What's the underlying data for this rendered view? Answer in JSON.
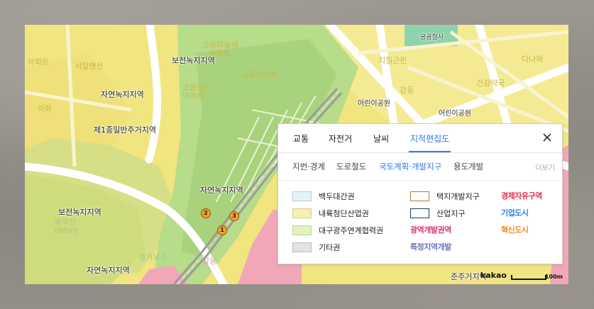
{
  "map": {
    "place_labels": [
      {
        "text": "보전녹지지역",
        "cls": ""
      },
      {
        "text": "자연녹지지역",
        "cls": ""
      },
      {
        "text": "제1종일반주거지역",
        "cls": ""
      },
      {
        "text": "자연녹지지역",
        "cls": ""
      },
      {
        "text": "보전녹지지역",
        "cls": ""
      },
      {
        "text": "자연녹지지역",
        "cls": ""
      },
      {
        "text": "어린이공원",
        "cls": "dark"
      },
      {
        "text": "어린이공원",
        "cls": "dark"
      },
      {
        "text": "공공청사",
        "cls": "dark"
      },
      {
        "text": "준주거지역",
        "cls": "dark"
      }
    ],
    "faint_labels": [
      "아파트",
      "서일맨션",
      "고등하늘채",
      "아파트",
      "고등현시",
      "아파트",
      "교동아파트",
      "치킬근린",
      "강동",
      "건강약국",
      "이화",
      "화부산",
      "(68m)",
      "경가유수",
      "강동",
      "다나와"
    ],
    "markers": [
      "1",
      "2",
      "3"
    ],
    "attribution": {
      "logo": "kakao",
      "scale": "100m"
    }
  },
  "panel": {
    "tabs": [
      {
        "label": "교통",
        "active": false
      },
      {
        "label": "자전거",
        "active": false
      },
      {
        "label": "날씨",
        "active": false
      },
      {
        "label": "지적편집도",
        "active": true
      }
    ],
    "subtabs": [
      {
        "label": "지번·경계",
        "active": false
      },
      {
        "label": "도로철도",
        "active": false
      },
      {
        "label": "국토계획·개발지구",
        "active": true
      },
      {
        "label": "용도개발",
        "active": false
      }
    ],
    "more_label": "더보기",
    "legend": [
      {
        "label": "백두대간권",
        "color": "#e6f3f6",
        "border": "#b8cfd6"
      },
      {
        "label": "내륙첨단산업권",
        "color": "#f7f0b5",
        "border": "#d8cf80"
      },
      {
        "label": "대구광주연계협력권",
        "color": "#e2f3c2",
        "border": "#b9d48c"
      },
      {
        "label": "기타권",
        "color": "#e2e2e2",
        "border": "#bdbdbd"
      },
      {
        "label": "택지개발지구",
        "color": "#ffffff",
        "border": "#b97a3a"
      },
      {
        "label": "산업지구",
        "color": "#ffffff",
        "border": "#1e3a5f"
      }
    ],
    "badges": [
      {
        "text": "광역개발권역",
        "color": "#d9357a"
      },
      {
        "text": "특정지역개발",
        "color": "#6a77b8"
      },
      {
        "text": "경제자유구역",
        "color": "#e03050"
      },
      {
        "text": "기업도시",
        "color": "#2f80e0"
      },
      {
        "text": "혁신도시",
        "color": "#f08a20"
      }
    ]
  }
}
